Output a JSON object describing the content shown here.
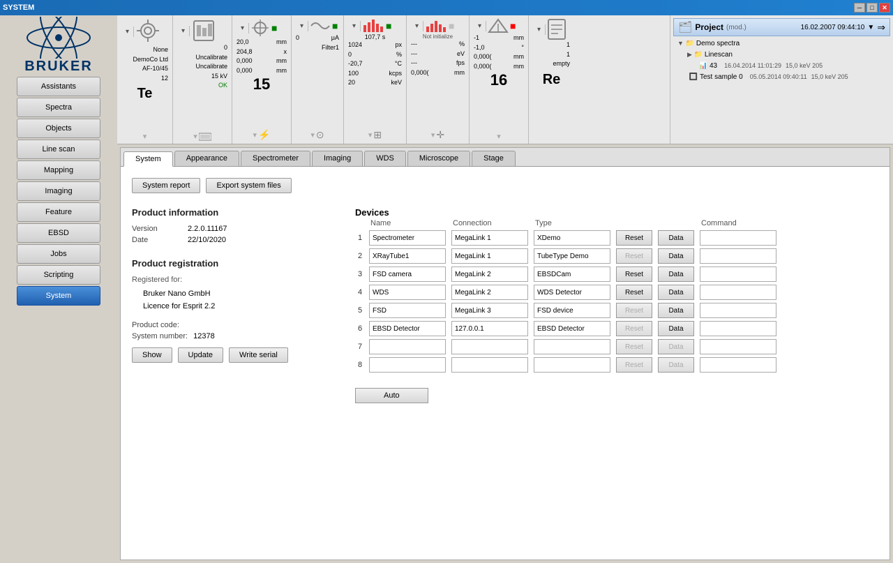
{
  "titleBar": {
    "title": "SYSTEM",
    "controls": [
      "─",
      "□",
      "✕"
    ]
  },
  "toolbar": {
    "sections": [
      {
        "id": "microscope",
        "icon": "⚛",
        "lines": [
          {
            "label": "None",
            "value": ""
          },
          {
            "label": "DemoCo Ltd",
            "value": ""
          },
          {
            "label": "AF-10/45",
            "value": ""
          },
          {
            "label": "12",
            "value": ""
          }
        ],
        "bigVal": "Te",
        "indicator": "none"
      },
      {
        "id": "detector",
        "icon": "📊",
        "lines": [
          {
            "label": "0",
            "value": ""
          },
          {
            "label": "Uncalibrate",
            "value": ""
          },
          {
            "label": "Uncalibrate",
            "value": ""
          },
          {
            "label": "15 kV",
            "value": ""
          },
          {
            "label": "OK",
            "value": ""
          }
        ],
        "bigVal": ""
      },
      {
        "id": "beam",
        "icon": "⊕",
        "lines": [
          {
            "label": "20,0",
            "unit": "mm"
          },
          {
            "label": "204,8",
            "unit": "x"
          },
          {
            "label": "0,000",
            "unit": "mm"
          },
          {
            "label": "0,000",
            "unit": "mm"
          }
        ],
        "bigVal": "15",
        "indicator": "green"
      },
      {
        "id": "current",
        "icon": "~",
        "lines": [
          {
            "label": "0",
            "unit": "μA"
          },
          {
            "label": "Filter1",
            "value": ""
          },
          {
            "label": "",
            "value": ""
          }
        ],
        "bigVal": "",
        "indicator": "green"
      },
      {
        "id": "spectrum",
        "icon": "📈",
        "lines": [
          {
            "label": "---",
            "unit": "%"
          },
          {
            "label": "1024",
            "unit": "px"
          },
          {
            "label": "0",
            "unit": "%"
          },
          {
            "label": "-20,7",
            "unit": "°C"
          },
          {
            "label": "100",
            "unit": "kcps"
          },
          {
            "label": "20",
            "unit": "keV"
          }
        ],
        "bigVal": "",
        "time": "107,7 s",
        "indicator": "green"
      },
      {
        "id": "eds",
        "icon": "📊",
        "lines": [
          {
            "label": "---",
            "unit": "%"
          },
          {
            "label": "---",
            "unit": "eV"
          },
          {
            "label": "---",
            "unit": "fps"
          },
          {
            "label": "0,000(",
            "unit": "mm"
          }
        ],
        "bigVal": "",
        "status": "Not initialize",
        "indicator": "none"
      },
      {
        "id": "stage",
        "icon": "⊕",
        "lines": [
          {
            "label": "-1",
            "unit": "mm"
          },
          {
            "label": "-1,0",
            "unit": "°"
          },
          {
            "label": "0,000(",
            "unit": "mm"
          },
          {
            "label": "0,000(",
            "unit": "mm"
          }
        ],
        "bigVal": "16",
        "indicator": "red"
      },
      {
        "id": "report",
        "icon": "📄",
        "lines": [
          {
            "label": "1",
            "value": ""
          },
          {
            "label": "1",
            "value": ""
          },
          {
            "label": "empty",
            "value": ""
          }
        ],
        "bigVal": "Re"
      }
    ]
  },
  "project": {
    "title": "Project",
    "mod": "(mod.)",
    "date": "16.02.2007 09:44:10",
    "arrow": "▼",
    "items": [
      {
        "type": "folder",
        "label": "Demo spectra",
        "expanded": true,
        "children": [
          {
            "type": "folder",
            "label": "Linescan",
            "expanded": false
          },
          {
            "type": "item",
            "label": "43",
            "date": "16.04.2014 11:01:29",
            "extra": "15,0 keV 205"
          }
        ]
      },
      {
        "type": "item",
        "label": "Test sample 0",
        "date": "05.05.2014 09:40:11",
        "extra": "15,0 keV 205"
      }
    ]
  },
  "tabs": {
    "items": [
      "System",
      "Appearance",
      "Spectrometer",
      "Imaging",
      "WDS",
      "Microscope",
      "Stage"
    ],
    "active": "System"
  },
  "systemPanel": {
    "buttons": {
      "systemReport": "System report",
      "exportFiles": "Export system files"
    },
    "productInfo": {
      "title": "Product information",
      "versionLabel": "Version",
      "versionValue": "2.2.0.11167",
      "dateLabel": "Date",
      "dateValue": "22/10/2020"
    },
    "productReg": {
      "title": "Product registration",
      "registeredFor": "Registered for:",
      "company": "Bruker Nano GmbH",
      "licence": "Licence for Esprit 2.2",
      "productCodeLabel": "Product code:",
      "systemNumberLabel": "System number:",
      "systemNumberValue": "12378",
      "buttons": {
        "show": "Show",
        "update": "Update",
        "writeSerial": "Write serial"
      }
    },
    "devices": {
      "title": "Devices",
      "columns": {
        "num": "#",
        "name": "Name",
        "connection": "Connection",
        "type": "Type",
        "command": "Command"
      },
      "rows": [
        {
          "num": 1,
          "name": "Spectrometer",
          "connection": "MegaLink 1",
          "type": "XDemo",
          "resetEnabled": true,
          "dataEnabled": true,
          "command": ""
        },
        {
          "num": 2,
          "name": "XRayTube1",
          "connection": "MegaLink 1",
          "type": "TubeType Demo",
          "resetEnabled": false,
          "dataEnabled": true,
          "command": ""
        },
        {
          "num": 3,
          "name": "FSD camera",
          "connection": "MegaLink 2",
          "type": "EBSDCam",
          "resetEnabled": true,
          "dataEnabled": true,
          "command": ""
        },
        {
          "num": 4,
          "name": "WDS",
          "connection": "MegaLink 2",
          "type": "WDS Detector",
          "resetEnabled": true,
          "dataEnabled": true,
          "command": ""
        },
        {
          "num": 5,
          "name": "FSD",
          "connection": "MegaLink 3",
          "type": "FSD device",
          "resetEnabled": false,
          "dataEnabled": true,
          "command": ""
        },
        {
          "num": 6,
          "name": "EBSD Detector",
          "connection": "127.0.0.1",
          "type": "EBSD Detector",
          "resetEnabled": false,
          "dataEnabled": true,
          "command": ""
        },
        {
          "num": 7,
          "name": "",
          "connection": "",
          "type": "",
          "resetEnabled": false,
          "dataEnabled": false,
          "command": ""
        },
        {
          "num": 8,
          "name": "",
          "connection": "",
          "type": "",
          "resetEnabled": false,
          "dataEnabled": false,
          "command": ""
        }
      ],
      "autoButton": "Auto"
    }
  },
  "sidebar": {
    "items": [
      {
        "label": "Assistants",
        "active": false
      },
      {
        "label": "Spectra",
        "active": false
      },
      {
        "label": "Objects",
        "active": false
      },
      {
        "label": "Line scan",
        "active": false
      },
      {
        "label": "Mapping",
        "active": false
      },
      {
        "label": "Imaging",
        "active": false
      },
      {
        "label": "Feature",
        "active": false
      },
      {
        "label": "EBSD",
        "active": false
      },
      {
        "label": "Jobs",
        "active": false
      },
      {
        "label": "Scripting",
        "active": false
      },
      {
        "label": "System",
        "active": true
      }
    ]
  }
}
